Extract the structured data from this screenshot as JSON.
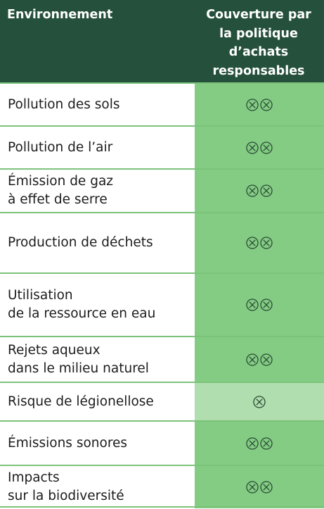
{
  "header": {
    "left": "Environnement",
    "right_lines": [
      "Couverture par",
      "la politique",
      "d’achats",
      "responsables"
    ]
  },
  "rows": [
    {
      "label_lines": [
        "Pollution des sols"
      ],
      "marks": 2,
      "shade": "medium"
    },
    {
      "label_lines": [
        "Pollution de l’air"
      ],
      "marks": 2,
      "shade": "medium"
    },
    {
      "label_lines": [
        "Émission de gaz",
        "à effet de serre"
      ],
      "marks": 2,
      "shade": "medium"
    },
    {
      "label_lines": [
        "Production de déchets"
      ],
      "marks": 2,
      "shade": "medium"
    },
    {
      "label_lines": [
        "Utilisation",
        "de la ressource en eau"
      ],
      "marks": 2,
      "shade": "medium"
    },
    {
      "label_lines": [
        "Rejets aqueux",
        "dans le milieu naturel"
      ],
      "marks": 2,
      "shade": "medium"
    },
    {
      "label_lines": [
        "Risque de légionellose"
      ],
      "marks": 1,
      "shade": "light"
    },
    {
      "label_lines": [
        "Émissions sonores"
      ],
      "marks": 2,
      "shade": "medium"
    },
    {
      "label_lines": [
        "Impacts",
        "sur la biodiversité"
      ],
      "marks": 2,
      "shade": "medium"
    }
  ],
  "icons": {
    "mark": "circled-x-icon"
  },
  "colors": {
    "header_bg": "#25503c",
    "header_text": "#ffffff",
    "cell_medium": "#84cc84",
    "cell_light": "#b0deae",
    "divider": "#7cc37a"
  }
}
